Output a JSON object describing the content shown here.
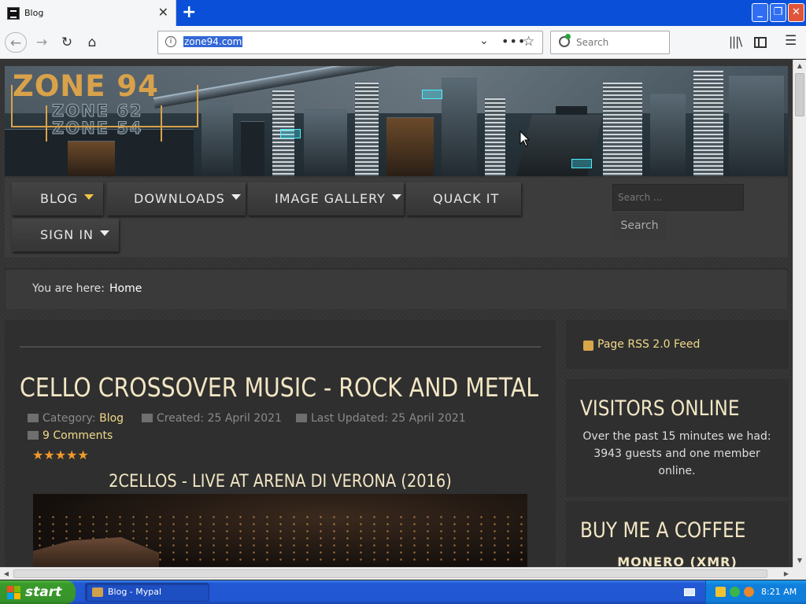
{
  "browser": {
    "tab_title": "Blog",
    "url": "zone94.com",
    "search_placeholder": "Search",
    "tab_close_glyph": "✕",
    "new_tab_glyph": "+",
    "win_min_glyph": "_",
    "win_max_glyph": "❐",
    "win_close_glyph": "✕"
  },
  "site": {
    "logo": {
      "line1": "ZONE 94",
      "line2": "ZONE 62",
      "line3": "ZONE 54"
    },
    "menu": [
      {
        "label": "BLOG",
        "has_dropdown": true,
        "active": true
      },
      {
        "label": "DOWNLOADS",
        "has_dropdown": true
      },
      {
        "label": "IMAGE GALLERY",
        "has_dropdown": true
      },
      {
        "label": "QUACK IT",
        "has_dropdown": false
      },
      {
        "label": "SIGN IN",
        "has_dropdown": true
      }
    ],
    "search_placeholder": "Search ...",
    "search_button": "Search",
    "breadcrumb": {
      "label": "You are here:",
      "current": "Home"
    }
  },
  "article": {
    "title": "CELLO CROSSOVER MUSIC - ROCK AND METAL",
    "category_label": "Category:",
    "category": "Blog",
    "created": "Created: 25 April 2021",
    "updated": "Last Updated: 25 April 2021",
    "comments": "9 Comments",
    "rating_stars": "★★★★★",
    "video_title": "2CELLOS - LIVE AT ARENA DI VERONA (2016)"
  },
  "sidebar": {
    "rss": "Page RSS 2.0 Feed",
    "visitors_title": "VISITORS ONLINE",
    "visitors_text": "Over the past 15 minutes we had: 3943 guests and one member online.",
    "coffee_title": "BUY ME A COFFEE",
    "coffee_sub": "MONERO (XMR)"
  },
  "taskbar": {
    "start": "start",
    "task": "Blog - Mypal",
    "clock": "8:21 AM"
  },
  "colors": {
    "accent_gold": "#f0d98a",
    "title_cream": "#f2e6c4",
    "star_orange": "#f19a2a",
    "xp_blue": "#2157d2",
    "xp_green": "#3a9a2a"
  }
}
